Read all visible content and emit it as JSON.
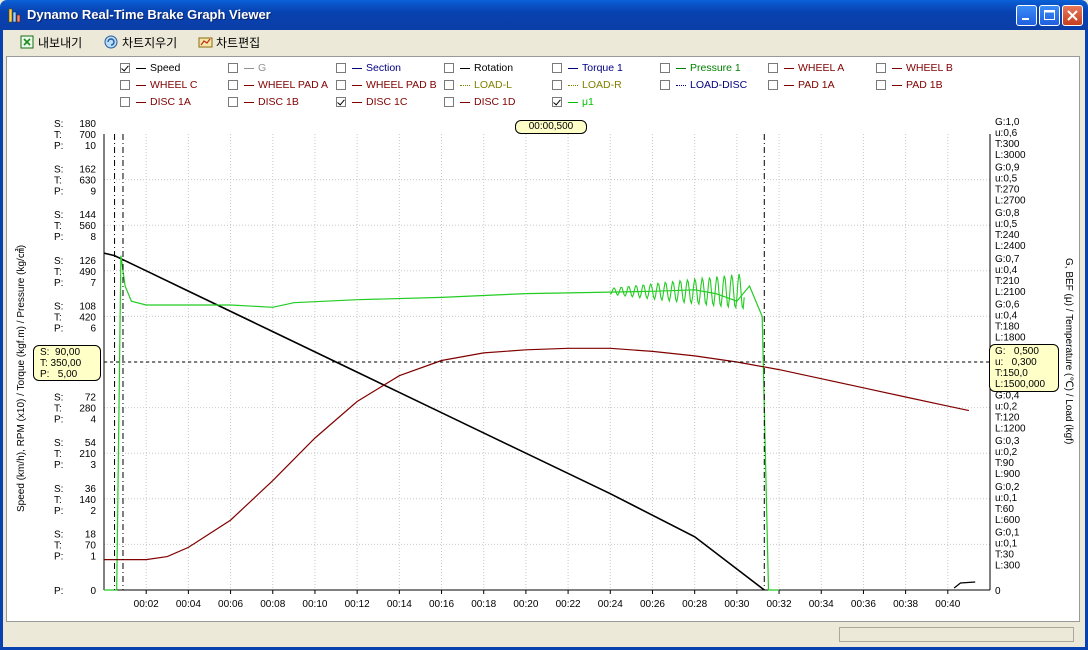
{
  "window": {
    "title": "Dynamo Real-Time Brake Graph Viewer"
  },
  "toolbar": {
    "items": [
      {
        "label": "내보내기",
        "icon": "export-icon"
      },
      {
        "label": "차트지우기",
        "icon": "clear-chart-icon"
      },
      {
        "label": "차트편집",
        "icon": "edit-chart-icon"
      }
    ]
  },
  "legend": [
    {
      "label": "Speed",
      "checked": true,
      "color": "#000000",
      "style": "solid"
    },
    {
      "label": "G",
      "checked": false,
      "color": "#909090",
      "style": "solid"
    },
    {
      "label": "Section",
      "checked": false,
      "color": "#000080",
      "style": "solid"
    },
    {
      "label": "Rotation",
      "checked": false,
      "color": "#000000",
      "style": "solid"
    },
    {
      "label": "Torque 1",
      "checked": false,
      "color": "#000080",
      "style": "solid"
    },
    {
      "label": "Pressure 1",
      "checked": false,
      "color": "#008000",
      "style": "solid"
    },
    {
      "label": "WHEEL A",
      "checked": false,
      "color": "#800000",
      "style": "solid"
    },
    {
      "label": "WHEEL B",
      "checked": false,
      "color": "#800000",
      "style": "solid"
    },
    {
      "label": "WHEEL C",
      "checked": false,
      "color": "#800000",
      "style": "solid"
    },
    {
      "label": "WHEEL PAD A",
      "checked": false,
      "color": "#800000",
      "style": "solid"
    },
    {
      "label": "WHEEL PAD B",
      "checked": false,
      "color": "#800000",
      "style": "solid"
    },
    {
      "label": "LOAD-L",
      "checked": false,
      "color": "#808000",
      "style": "dotted"
    },
    {
      "label": "LOAD-R",
      "checked": false,
      "color": "#808000",
      "style": "dotted"
    },
    {
      "label": "LOAD-DISC",
      "checked": false,
      "color": "#000080",
      "style": "dotted"
    },
    {
      "label": "PAD 1A",
      "checked": false,
      "color": "#800000",
      "style": "solid"
    },
    {
      "label": "PAD 1B",
      "checked": false,
      "color": "#800000",
      "style": "solid"
    },
    {
      "label": "DISC 1A",
      "checked": false,
      "color": "#800000",
      "style": "solid"
    },
    {
      "label": "DISC 1B",
      "checked": false,
      "color": "#800000",
      "style": "solid"
    },
    {
      "label": "DISC 1C",
      "checked": true,
      "color": "#800000",
      "style": "solid"
    },
    {
      "label": "DISC 1D",
      "checked": false,
      "color": "#800000",
      "style": "solid"
    },
    {
      "label": "μ1",
      "checked": true,
      "color": "#00c000",
      "style": "solid"
    }
  ],
  "chart": {
    "time_marker": "00:00,500",
    "left_axis_title": "Speed (km/h), RPM (x10) / Torque (kgf.m) / Pressure (kg/㎠)",
    "right_axis_title": "G, BEF (μ) / Temperature (℃) / Load (kgf)",
    "left_ticks": [
      {
        "S": "180",
        "T": "700",
        "P": "10"
      },
      {
        "S": "162",
        "T": "630",
        "P": "9"
      },
      {
        "S": "144",
        "T": "560",
        "P": "8"
      },
      {
        "S": "126",
        "T": "490",
        "P": "7"
      },
      {
        "S": "108",
        "T": "420",
        "P": "6"
      },
      {
        "S": "",
        "T": "",
        "P": ""
      },
      {
        "S": "72",
        "T": "280",
        "P": "4"
      },
      {
        "S": "54",
        "T": "210",
        "P": "3"
      },
      {
        "S": "36",
        "T": "140",
        "P": "2"
      },
      {
        "S": "18",
        "T": "70",
        "P": "1"
      },
      {
        "S": "",
        "T": "",
        "P": "0"
      }
    ],
    "right_ticks": [
      {
        "G": "1,0",
        "u": "0,6",
        "T": "300",
        "L": "3000"
      },
      {
        "G": "0,9",
        "u": "0,5",
        "T": "270",
        "L": "2700"
      },
      {
        "G": "0,8",
        "u": "0,5",
        "T": "240",
        "L": "2400"
      },
      {
        "G": "0,7",
        "u": "0,4",
        "T": "210",
        "L": "2100"
      },
      {
        "G": "0,6",
        "u": "0,4",
        "T": "180",
        "L": "1800"
      },
      {
        "G": "0,5",
        "u": "0,3",
        "T": "150",
        "L": "1500"
      },
      {
        "G": "0,4",
        "u": "0,2",
        "T": "120",
        "L": "1200"
      },
      {
        "G": "0,3",
        "u": "0,2",
        "T": "90",
        "L": "900"
      },
      {
        "G": "0,2",
        "u": "0,1",
        "T": "60",
        "L": "600"
      },
      {
        "G": "0,1",
        "u": "0,1",
        "T": "30",
        "L": "300"
      },
      {
        "G": "",
        "u": "",
        "T": "",
        "L": "0"
      }
    ],
    "x_ticks": [
      "00:02",
      "00:04",
      "00:06",
      "00:08",
      "00:10",
      "00:12",
      "00:14",
      "00:16",
      "00:18",
      "00:20",
      "00:22",
      "00:24",
      "00:26",
      "00:28",
      "00:30",
      "00:32",
      "00:34",
      "00:36",
      "00:38",
      "00:40"
    ],
    "cursor_left": {
      "S": "S:  90,00",
      "T": "T: 350,00",
      "P": "P:   5,00"
    },
    "cursor_right": {
      "G": "G:   0,500",
      "u": "u:   0,300",
      "T": "T:150,0",
      "L": "L:1500,000"
    }
  },
  "chart_data": {
    "type": "line",
    "xlabel": "",
    "x_unit": "time (s)",
    "xlim": [
      0,
      42
    ],
    "left_ylabel": "Speed (km/h), RPM (x10) / Torque (kgf.m) / Pressure (kg/㎠)",
    "right_ylabel": "G, BEF (μ) / Temperature (℃) / Load (kgf)",
    "series": [
      {
        "name": "Speed",
        "color": "#000000",
        "axis": "S (0-180)",
        "x": [
          0,
          0.5,
          1,
          2,
          4,
          8,
          12,
          16,
          20,
          24,
          28,
          31.3
        ],
        "y": [
          133,
          132,
          130,
          126,
          118,
          102,
          86,
          70,
          54,
          38,
          21,
          0
        ]
      },
      {
        "name": "μ1",
        "color": "#22cc22",
        "axis": "u (0-0.6)",
        "x": [
          0,
          0.6,
          0.8,
          1.0,
          1.3,
          2,
          4,
          6,
          8,
          9,
          12,
          16,
          20,
          24,
          26,
          28,
          29,
          30,
          30.6,
          31.2,
          31.5,
          32
        ],
        "y": [
          0.0,
          0.0,
          0.44,
          0.4,
          0.38,
          0.375,
          0.375,
          0.375,
          0.372,
          0.378,
          0.382,
          0.385,
          0.39,
          0.392,
          0.393,
          0.395,
          0.39,
          0.38,
          0.4,
          0.36,
          0.0,
          0.0
        ]
      },
      {
        "name": "DISC 1C",
        "color": "#800000",
        "axis": "T (0-300)",
        "x": [
          0,
          1,
          2,
          3,
          4,
          6,
          8,
          10,
          12,
          14,
          16,
          18,
          20,
          22,
          24,
          26,
          28,
          30,
          32,
          34,
          36,
          38,
          40,
          41
        ],
        "y": [
          20,
          20,
          20,
          22,
          28,
          46,
          72,
          100,
          124,
          141,
          151,
          156,
          158,
          159,
          159,
          157,
          154,
          150,
          145,
          139,
          133,
          127,
          121,
          118
        ]
      }
    ]
  }
}
